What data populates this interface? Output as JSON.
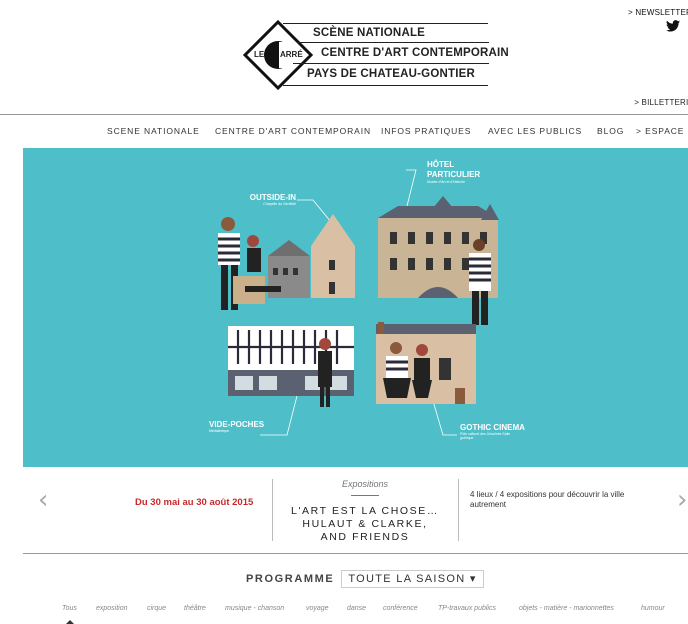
{
  "header": {
    "newsletter": "> NEWSLETTER",
    "billetterie": "> BILLETTERIE",
    "logo": {
      "monogram": "LE CARRÉ",
      "line1": "SCÈNE NATIONALE",
      "line2": "CENTRE D'ART CONTEMPORAIN",
      "line3": "PAYS DE CHATEAU-GONTIER"
    },
    "social_icon": "twitter-icon"
  },
  "nav": {
    "items": [
      "SCENE NATIONALE",
      "CENTRE D'ART CONTEMPORAIN",
      "INFOS PRATIQUES",
      "AVEC LES PUBLICS",
      "BLOG",
      "> ESPACE PRO"
    ]
  },
  "hero": {
    "background": "#4ebfc8",
    "labels": [
      {
        "title": "OUTSIDE-IN",
        "subtitle": "Chapelle du Genêteil"
      },
      {
        "title": "HÔTEL PARTICULIER",
        "subtitle": "Musée d'Art et d'Histoire"
      },
      {
        "title": "VIDE-POCHES",
        "subtitle": "Médiathèque"
      },
      {
        "title": "GOTHIC CINEMA",
        "subtitle": "Pôle culturel des Ursulines Salle gothique"
      }
    ]
  },
  "event": {
    "dates": "Du 30 mai au 30 août 2015",
    "category": "Expositions",
    "title_line1": "L'ART EST LA CHOSE…",
    "title_line2": "HULAUT & CLARKE,",
    "title_line3": "AND FRIENDS",
    "description": "4 lieux / 4 expositions pour découvrir la ville autrement",
    "prev_icon": "chevron-left-icon",
    "next_icon": "chevron-right-icon"
  },
  "programme": {
    "label": "PROGRAMME",
    "season": "TOUTE LA SAISON ▾"
  },
  "filters": [
    "Tous",
    "exposition",
    "cirque",
    "théâtre",
    "musique - chanson",
    "voyage",
    "danse",
    "conférence",
    "TP-travaux publics",
    "objets - matière - marionnettes",
    "humour"
  ]
}
